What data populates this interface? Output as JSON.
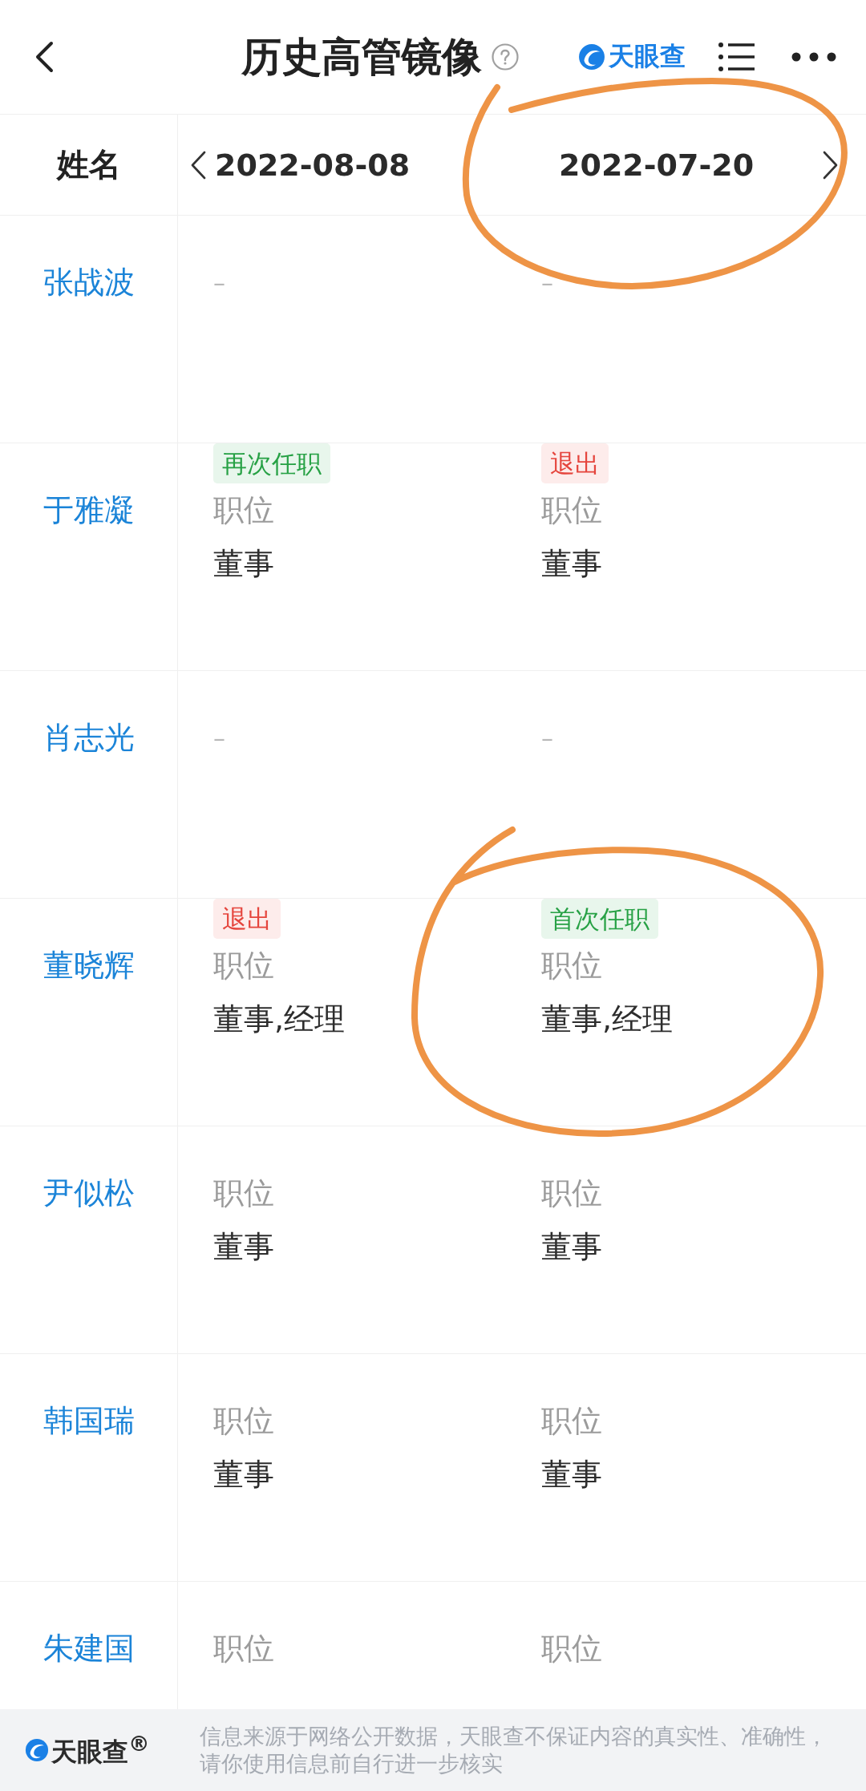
{
  "header": {
    "title": "历史高管镜像",
    "logo_text": "天眼查"
  },
  "table": {
    "name_heading": "姓名",
    "dates": [
      {
        "label": "2022-08-08",
        "circled": false
      },
      {
        "label": "2022-07-20",
        "circled": true
      }
    ],
    "rows": [
      {
        "name": "张战波",
        "cells": [
          {
            "kind": "empty",
            "text": "–",
            "circled": false
          },
          {
            "kind": "empty",
            "text": "–",
            "circled": false
          }
        ]
      },
      {
        "name": "于雅凝",
        "cells": [
          {
            "kind": "position",
            "tag": {
              "kind": "appointed",
              "text": "再次任职"
            },
            "label": "职位",
            "value": "董事",
            "circled": false
          },
          {
            "kind": "position",
            "tag": {
              "kind": "exited",
              "text": "退出"
            },
            "label": "职位",
            "value": "董事",
            "circled": false
          }
        ]
      },
      {
        "name": "肖志光",
        "cells": [
          {
            "kind": "empty",
            "text": "–",
            "circled": false
          },
          {
            "kind": "empty",
            "text": "–",
            "circled": false
          }
        ]
      },
      {
        "name": "董晓辉",
        "cells": [
          {
            "kind": "position",
            "tag": {
              "kind": "exited",
              "text": "退出"
            },
            "label": "职位",
            "value": "董事,经理",
            "circled": false
          },
          {
            "kind": "position",
            "tag": {
              "kind": "appointed",
              "text": "首次任职"
            },
            "label": "职位",
            "value": "董事,经理",
            "circled": true
          }
        ]
      },
      {
        "name": "尹似松",
        "cells": [
          {
            "kind": "position",
            "label": "职位",
            "value": "董事",
            "circled": false
          },
          {
            "kind": "position",
            "label": "职位",
            "value": "董事",
            "circled": false
          }
        ]
      },
      {
        "name": "韩国瑞",
        "cells": [
          {
            "kind": "position",
            "label": "职位",
            "value": "董事",
            "circled": false
          },
          {
            "kind": "position",
            "label": "职位",
            "value": "董事",
            "circled": false
          }
        ]
      },
      {
        "name": "朱建国",
        "cells": [
          {
            "kind": "position",
            "label": "职位",
            "circled": false
          },
          {
            "kind": "position",
            "label": "职位",
            "circled": false
          }
        ]
      }
    ]
  },
  "footer": {
    "logo_text": "天眼查$^{®}$",
    "disclaimer": "信息来源于网络公开数据，天眼查不保证内容的真实性、准确性，请你使用信息前自行进一步核实"
  }
}
